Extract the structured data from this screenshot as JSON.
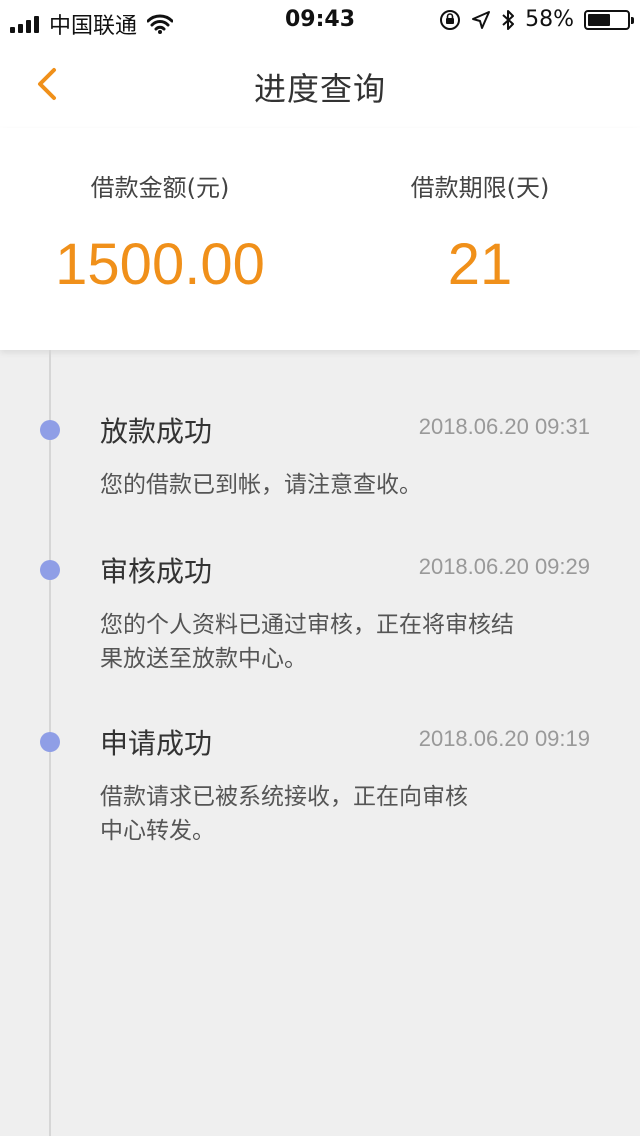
{
  "status_bar": {
    "carrier": "中国联通",
    "time": "09:43",
    "battery_percent": "58%",
    "battery_level": 0.58,
    "icons": [
      "signal-icon",
      "wifi-icon",
      "orientation-lock-icon",
      "location-icon",
      "bluetooth-icon",
      "battery-icon"
    ]
  },
  "header": {
    "title": "进度查询",
    "back_icon": "chevron-left-icon",
    "accent_color": "#f0901a"
  },
  "summary": {
    "amount_label": "借款金额(元)",
    "amount_value": "1500.00",
    "term_label": "借款期限(天)",
    "term_value": "21",
    "value_color": "#f0901a"
  },
  "timeline": {
    "dot_color": "#8f9ee6",
    "items": [
      {
        "title": "放款成功",
        "time": "2018.06.20 09:31",
        "desc_lines": [
          "您的借款已到帐，请注意查收。"
        ]
      },
      {
        "title": "审核成功",
        "time": "2018.06.20 09:29",
        "desc_lines": [
          "您的个人资料已通过审核，正在将审核结",
          "果放送至放款中心。"
        ]
      },
      {
        "title": "申请成功",
        "time": "2018.06.20 09:19",
        "desc_lines": [
          "借款请求已被系统接收，正在向审核",
          "中心转发。"
        ]
      }
    ]
  }
}
